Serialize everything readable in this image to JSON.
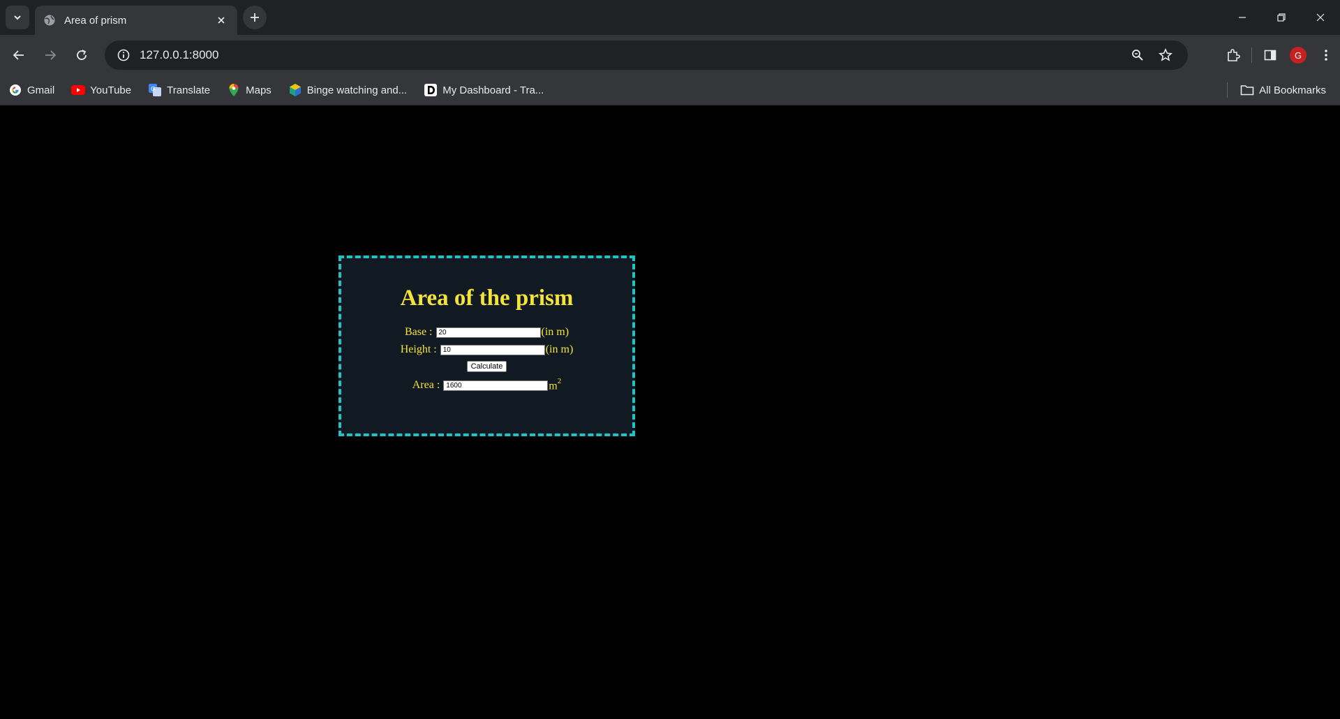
{
  "browser": {
    "tab": {
      "title": "Area of prism"
    },
    "address": {
      "url": "127.0.0.1:8000"
    },
    "profile": {
      "initial": "G"
    },
    "bookmarks": [
      {
        "label": "Gmail",
        "icon": "gmail-icon"
      },
      {
        "label": "YouTube",
        "icon": "youtube-icon"
      },
      {
        "label": "Translate",
        "icon": "translate-icon"
      },
      {
        "label": "Maps",
        "icon": "maps-icon"
      },
      {
        "label": "Binge watching and...",
        "icon": "binge-icon"
      },
      {
        "label": "My Dashboard - Tra...",
        "icon": "dashboard-icon"
      }
    ],
    "all_bookmarks_label": "All Bookmarks"
  },
  "colors": {
    "accent_text": "#f5e33b",
    "card_border": "#22c1c3",
    "card_background": "#111a22",
    "page_background": "#000000"
  },
  "calculator": {
    "title": "Area of the prism",
    "base": {
      "label": "Base :",
      "value": "20",
      "unit": "(in m)"
    },
    "height": {
      "label": "Height :",
      "value": "10",
      "unit": "(in m)"
    },
    "calculate_label": "Calculate",
    "area": {
      "label": "Area :",
      "value": "1600",
      "unit": "m",
      "unit_exponent": "2"
    }
  }
}
